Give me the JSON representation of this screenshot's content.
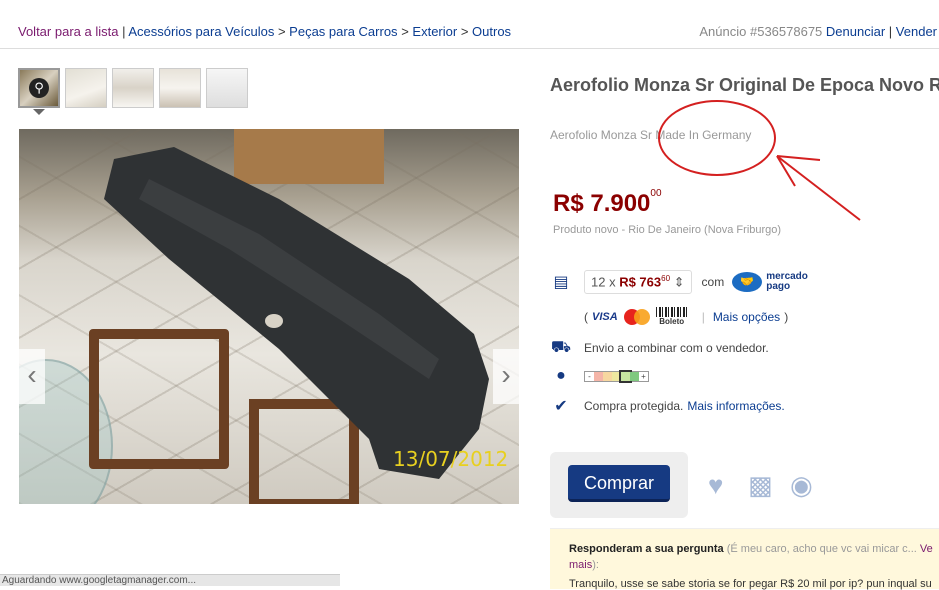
{
  "breadcrumb": {
    "back": "Voltar para a lista",
    "items": [
      "Acessórios para Veículos",
      "Peças para Carros",
      "Exterior",
      "Outros"
    ],
    "separator": ">"
  },
  "ad_info": {
    "id_text": "Anúncio #536578675",
    "report": "Denunciar",
    "sell": "Vender"
  },
  "gallery": {
    "photo_date_stamp": "13/07/2012",
    "prev_arrow": "‹",
    "next_arrow": "›"
  },
  "product": {
    "title": "Aerofolio Monza Sr Original De Epoca Novo Rarissimo",
    "subtitle": "Aerofolio Monza Sr Made In Germany",
    "price_main": "R$ 7.900",
    "price_cents": "00",
    "condition": "Produto novo -",
    "location": "Rio De Janeiro (Nova Friburgo)"
  },
  "payment": {
    "installments_prefix": "12 x",
    "installment_value": "R$ 763",
    "installment_cents": "60",
    "with": "com",
    "mp_line1": "mercado",
    "mp_line2": "pago",
    "open_paren": "(",
    "visa": "VISA",
    "master": "MasterCard",
    "boleto": "Boleto",
    "more_options": "Mais opções",
    "close_paren": ")"
  },
  "shipping": {
    "text": "Envio a combinar com o vendedor."
  },
  "protection": {
    "text": "Compra protegida.",
    "link": "Mais informações."
  },
  "buy": {
    "label": "Comprar"
  },
  "question": {
    "label": "Responderam a sua pergunta",
    "snippet": "(É meu caro, acho que vc vai micar c...",
    "more_a": "Ve",
    "more_b": "mais",
    "close": "):",
    "answer": "Tranquilo, usse se sabe storia se for pegar R$ 20 mil por ip? pun inqual su"
  },
  "status": {
    "text": "Aguardando www.googletagmanager.com..."
  },
  "colors": {
    "link": "#0b3d91",
    "price": "#8b0000",
    "buy_button": "#163a82",
    "annotation": "#d42020"
  }
}
